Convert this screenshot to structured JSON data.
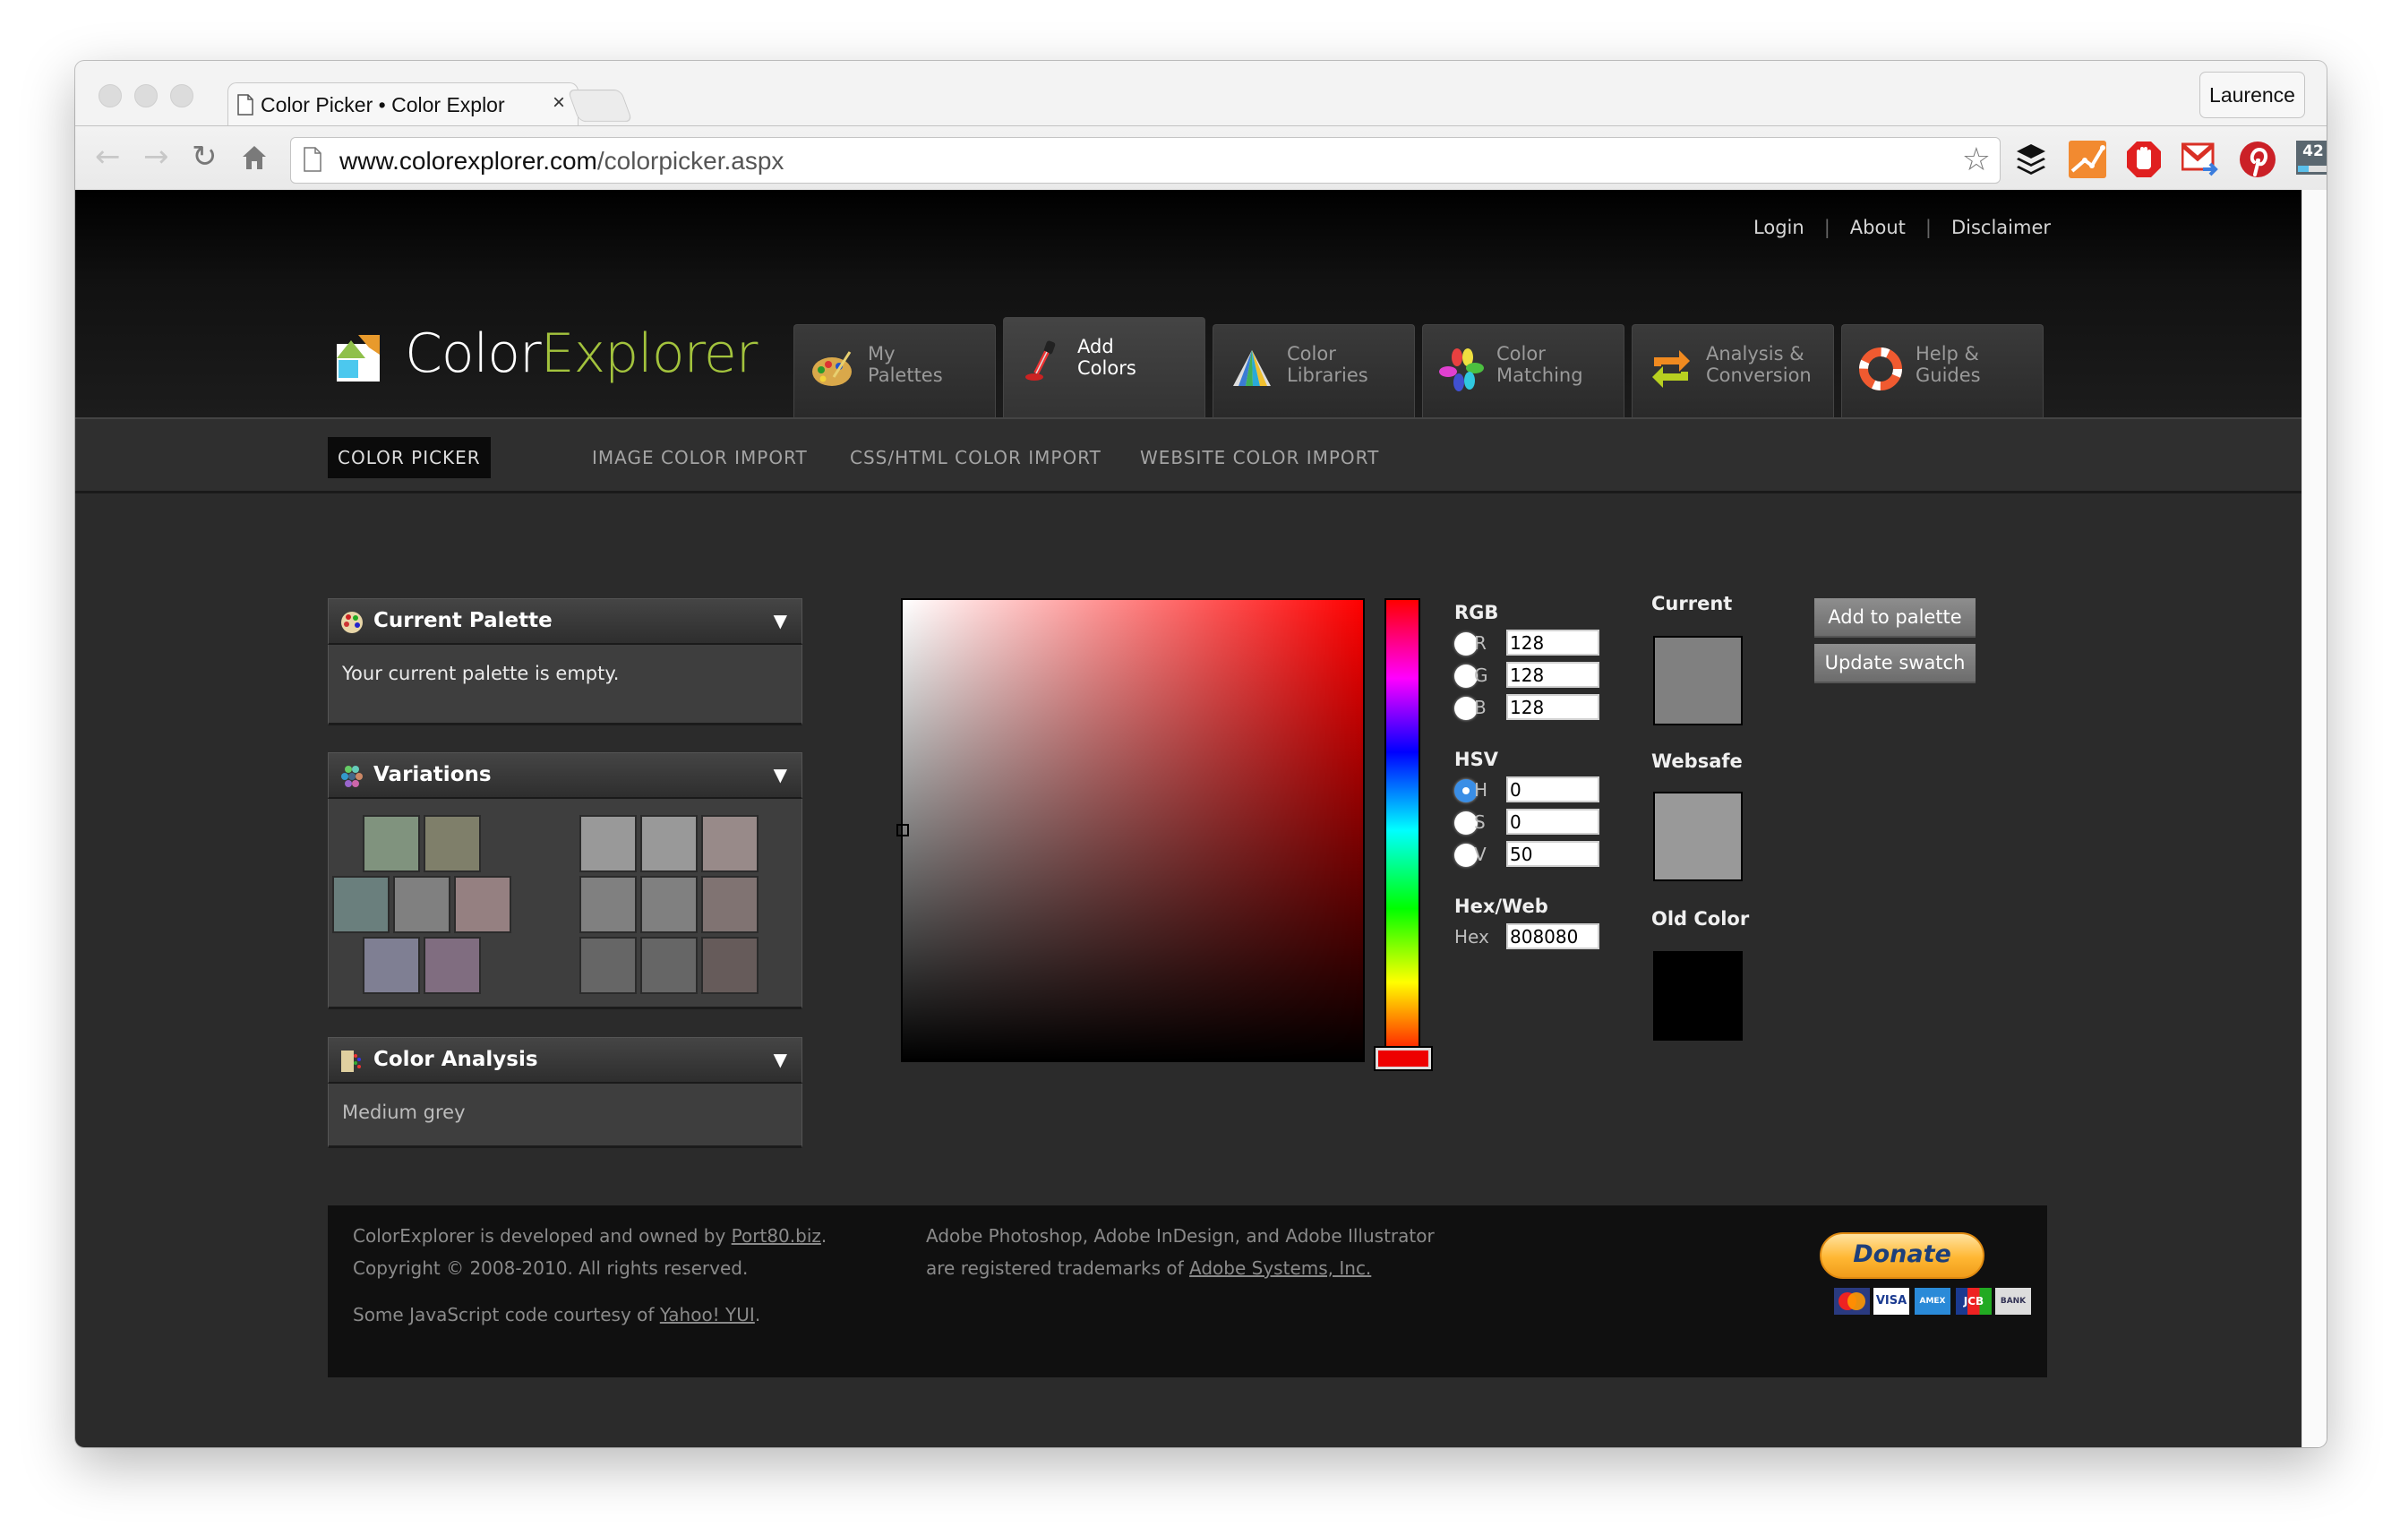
{
  "browser": {
    "tab_title": "Color Picker • Color Explor",
    "tab_close": "×",
    "profile": "Laurence",
    "url_host": "www.colorexplorer.com",
    "url_path": "/colorpicker.aspx",
    "extensions": [
      {
        "name": "buffer-icon",
        "color": "#111111"
      },
      {
        "name": "analytics-icon",
        "color": "#f28a30"
      },
      {
        "name": "adblock-icon",
        "color": "#e02020"
      },
      {
        "name": "gmail-icon",
        "color": "#d93025"
      },
      {
        "name": "pinterest-icon",
        "color": "#cb2027"
      },
      {
        "name": "counter-icon",
        "color": "#5a6770",
        "label": "42"
      }
    ]
  },
  "header": {
    "links": [
      "Login",
      "About",
      "Disclaimer"
    ],
    "logo": {
      "part1": "Color",
      "part2": "Explorer",
      "accent": "#a3c33d"
    },
    "tabs": [
      {
        "line1": "My",
        "line2": "Palettes",
        "icon": "palette-icon",
        "active": false
      },
      {
        "line1": "Add",
        "line2": "Colors",
        "icon": "eyedropper-icon",
        "active": true
      },
      {
        "line1": "Color",
        "line2": "Libraries",
        "icon": "swatch-fan-icon",
        "active": false
      },
      {
        "line1": "Color",
        "line2": "Matching",
        "icon": "flower-icon",
        "active": false
      },
      {
        "line1": "Analysis &",
        "line2": "Conversion",
        "icon": "convert-arrows-icon",
        "active": false
      },
      {
        "line1": "Help &",
        "line2": "Guides",
        "icon": "lifebuoy-icon",
        "active": false
      }
    ]
  },
  "subnav": {
    "items": [
      "COLOR PICKER",
      "IMAGE COLOR IMPORT",
      "CSS/HTML COLOR IMPORT",
      "WEBSITE COLOR IMPORT"
    ],
    "active": 0
  },
  "panels": {
    "current_palette": {
      "title": "Current Palette",
      "text": "Your current palette is empty."
    },
    "variations": {
      "title": "Variations",
      "left_swatches": [
        [
          "#80937e",
          "#7f7f6a"
        ],
        [
          "#6a7f7d",
          "#808080",
          "#958081"
        ],
        [
          "#7f7f93",
          "#806d80"
        ]
      ],
      "right_swatches": [
        [
          "#999999",
          "#999999",
          "#988a89"
        ],
        [
          "#808080",
          "#808080",
          "#807372"
        ],
        [
          "#666666",
          "#666666",
          "#665b5a"
        ]
      ]
    },
    "color_analysis": {
      "title": "Color Analysis",
      "text": "Medium grey"
    }
  },
  "picker": {
    "hue": 0,
    "saturation": 0,
    "value": 50,
    "rgb_label": "RGB",
    "rgb": [
      {
        "label": "R",
        "value": "128"
      },
      {
        "label": "G",
        "value": "128"
      },
      {
        "label": "B",
        "value": "128"
      }
    ],
    "hsv_label": "HSV",
    "hsv": [
      {
        "label": "H",
        "value": "0",
        "selected": true
      },
      {
        "label": "S",
        "value": "0"
      },
      {
        "label": "V",
        "value": "50"
      }
    ],
    "hex_group_label": "Hex/Web",
    "hex_label": "Hex",
    "hex_value": "808080"
  },
  "swatches": {
    "current_label": "Current",
    "current_color": "#808080",
    "websafe_label": "Websafe",
    "websafe_color": "#999999",
    "old_label": "Old Color",
    "old_color": "#000000"
  },
  "buttons": {
    "add": "Add to palette",
    "update": "Update swatch"
  },
  "footer": {
    "line1_pre": "ColorExplorer is developed and owned by ",
    "line1_link": "Port80.biz",
    "line1_post": ".",
    "line2": "Copyright © 2008-2010. All rights reserved.",
    "line3_pre": "Some JavaScript code courtesy of ",
    "line3_link": "Yahoo! YUI",
    "line3_post": ".",
    "adobe1": "Adobe Photoshop, Adobe InDesign, and Adobe Illustrator",
    "adobe2_pre": "are registered trademarks of ",
    "adobe2_link": "Adobe Systems, Inc.",
    "donate": "Donate",
    "cards": [
      "MasterCard",
      "VISA",
      "AMEX",
      "JCB",
      "BANK"
    ]
  }
}
